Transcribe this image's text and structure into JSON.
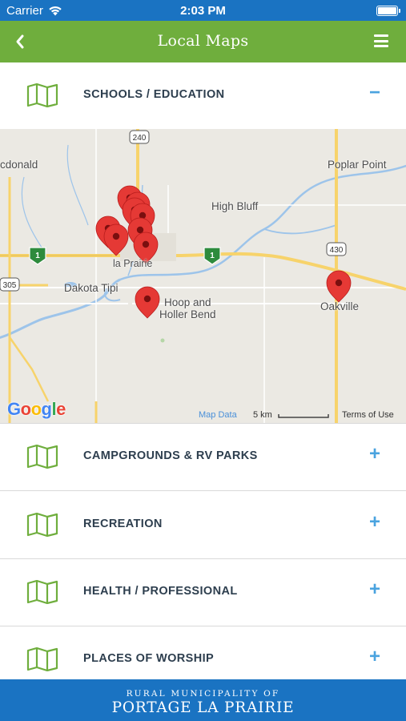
{
  "status_bar": {
    "carrier": "Carrier",
    "time": "2:03 PM"
  },
  "nav": {
    "title": "Local Maps"
  },
  "sections": [
    {
      "label": "SCHOOLS / EDUCATION",
      "toggle": "−",
      "expanded": true
    },
    {
      "label": "CAMPGROUNDS & RV PARKS",
      "toggle": "+",
      "expanded": false
    },
    {
      "label": "RECREATION",
      "toggle": "+",
      "expanded": false
    },
    {
      "label": "HEALTH / PROFESSIONAL",
      "toggle": "+",
      "expanded": false
    },
    {
      "label": "PLACES OF WORSHIP",
      "toggle": "+",
      "expanded": false
    }
  ],
  "map": {
    "places": {
      "macdonald": "cdonald",
      "poplar_point": "Poplar Point",
      "high_bluff": "High Bluff",
      "dakota_tipi": "Dakota Tipi",
      "hoop_holler_1": "Hoop and",
      "hoop_holler_2": "Holler Bend",
      "oakville": "Oakville",
      "portage_fragment": "la Prairie"
    },
    "route_shields": {
      "r240": "240",
      "r430": "430",
      "r305": "305",
      "hwy1a": "1",
      "hwy1b": "1"
    },
    "google_logo": "Google",
    "map_data": "Map Data",
    "scale": "5 km",
    "terms": "Terms of Use"
  },
  "footer": {
    "line1": "RURAL MUNICIPALITY OF",
    "line2": "PORTAGE LA PRAIRIE"
  },
  "colors": {
    "status_bar": "#1a73c2",
    "nav_bar": "#6fae3d",
    "icon_green": "#6fae3d",
    "label_text": "#2d3e4e",
    "toggle_blue": "#4aa3df",
    "marker_red": "#e53935",
    "road_yellow": "#f7d36b",
    "water_blue": "#9dc4ea"
  }
}
